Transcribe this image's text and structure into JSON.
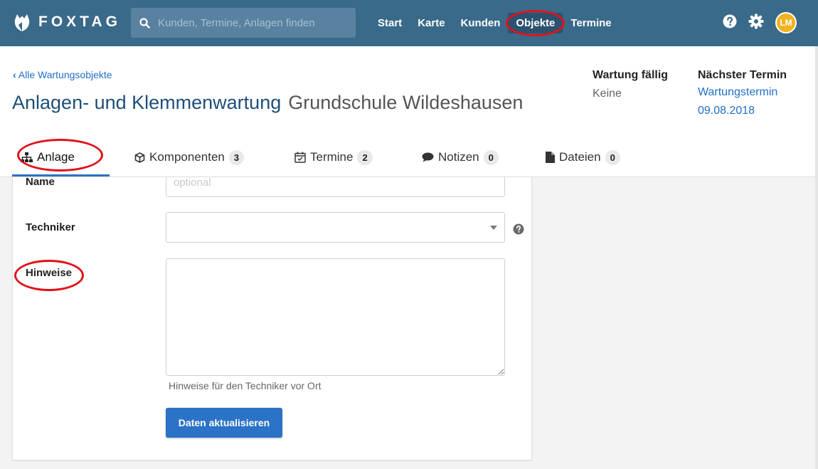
{
  "app": {
    "brand": "FOXTAG"
  },
  "search": {
    "placeholder": "Kunden, Termine, Anlagen finden"
  },
  "nav": {
    "items": [
      {
        "label": "Start"
      },
      {
        "label": "Karte"
      },
      {
        "label": "Kunden"
      },
      {
        "label": "Objekte",
        "active": true
      },
      {
        "label": "Termine"
      }
    ]
  },
  "user": {
    "initials": "LM"
  },
  "header": {
    "back_link": "Alle Wartungsobjekte",
    "title": "Anlagen- und Klemmenwartung",
    "subtitle": "Grundschule Wildeshausen",
    "due_label": "Wartung fällig",
    "due_value": "Keine",
    "next_label": "Nächster Termin",
    "next_line1": "Wartungstermin",
    "next_line2": "09.08.2018"
  },
  "tabs": [
    {
      "label": "Anlage",
      "badge": ""
    },
    {
      "label": "Komponenten",
      "badge": "3"
    },
    {
      "label": "Termine",
      "badge": "2"
    },
    {
      "label": "Notizen",
      "badge": "0"
    },
    {
      "label": "Dateien",
      "badge": "0"
    }
  ],
  "form": {
    "name_label": "Name",
    "name_placeholder": "optional",
    "technician_label": "Techniker",
    "technician_value": "",
    "notes_label": "Hinweise",
    "notes_value": "",
    "notes_hint": "Hinweise für den Techniker vor Ort",
    "submit_label": "Daten aktualisieren"
  },
  "colors": {
    "topbar": "#3a6a8a",
    "primary": "#2b73c6",
    "annotation": "#e0121b",
    "avatar": "#f2b320"
  }
}
